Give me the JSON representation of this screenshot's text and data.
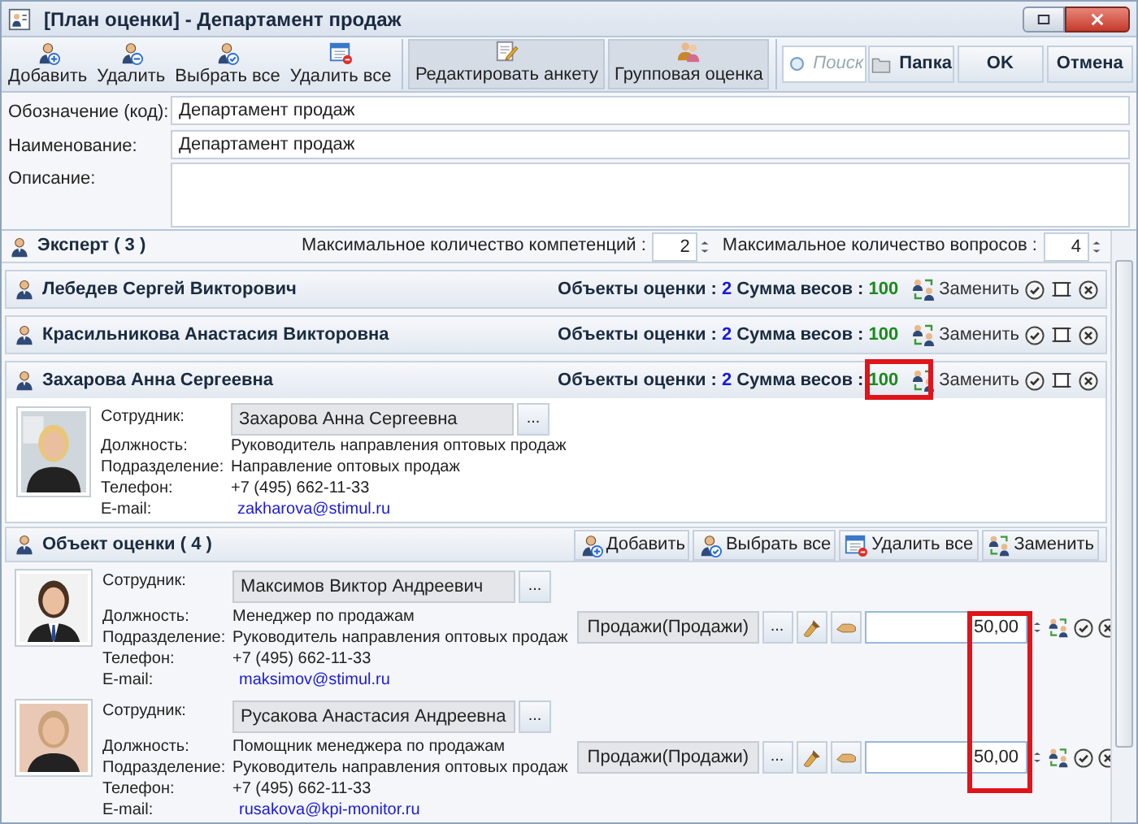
{
  "window": {
    "title": "[План оценки] - Департамент продаж"
  },
  "toolbar": {
    "buttons": [
      {
        "label": "Добавить",
        "kind": "add"
      },
      {
        "label": "Удалить",
        "kind": "remove"
      },
      {
        "label": "Выбрать все",
        "kind": "select"
      },
      {
        "label": "Удалить все",
        "kind": "clear"
      },
      {
        "label": "Редактировать анкету",
        "kind": "edit"
      },
      {
        "label": "Групповая оценка",
        "kind": "group"
      }
    ],
    "search": {
      "placeholder": "Поиск"
    },
    "actions": [
      {
        "label": "Папка",
        "kind": "folder"
      },
      {
        "label": "OK",
        "kind": "plain"
      },
      {
        "label": "Отмена",
        "kind": "plain"
      }
    ]
  },
  "fields": [
    {
      "label": "Обозначение (код):",
      "value": "Департамент продаж",
      "kind": "line"
    },
    {
      "label": "Наименование:",
      "value": "Департамент продаж",
      "kind": "line"
    },
    {
      "label": "Описание:",
      "kind": "area"
    }
  ],
  "experts": {
    "title": "Эксперт ( 3 )",
    "max_competencies": {
      "label": "Максимальное количество компетенций :",
      "value": "2"
    },
    "max_questions": {
      "label": "Максимальное количество вопросов :",
      "value": "4"
    },
    "items": [
      {
        "name": "Лебедев Сергей Викторович",
        "objects_label": "Объекты оценки :",
        "objects_value": "2",
        "weights_label": "Сумма весов :",
        "weights_value": "100",
        "replace": "Заменить"
      },
      {
        "name": "Красильникова Анастасия Викторовна",
        "objects_label": "Объекты оценки :",
        "objects_value": "2",
        "weights_label": "Сумма весов :",
        "weights_value": "100",
        "replace": "Заменить"
      },
      {
        "name": "Захарова Анна Сергеевна",
        "objects_label": "Объекты оценки :",
        "objects_value": "2",
        "weights_label": "Сумма весов :",
        "weights_value": "100",
        "replace": "Заменить",
        "details": [
          {
            "label": "Сотрудник:",
            "value": "Захарова Анна Сергеевна",
            "kind": "field",
            "more": "..."
          },
          {
            "label": "Должность:",
            "value": "Руководитель направления оптовых продаж",
            "kind": "text"
          },
          {
            "label": "Подразделение:",
            "value": "Направление оптовых продаж",
            "kind": "text"
          },
          {
            "label": "Телефон:",
            "value": "+7 (495) 662-11-33",
            "kind": "text"
          },
          {
            "label": "E-mail:",
            "value": "zakharova@stimul.ru",
            "kind": "link"
          }
        ]
      }
    ]
  },
  "objects": {
    "title": "Объект оценки ( 4 )",
    "buttons": [
      {
        "label": "Добавить",
        "kind": "add"
      },
      {
        "label": "Выбрать все",
        "kind": "select"
      },
      {
        "label": "Удалить все",
        "kind": "clear"
      },
      {
        "label": "Заменить",
        "kind": "replace"
      }
    ],
    "items": [
      {
        "details": [
          {
            "label": "Сотрудник:",
            "value": "Максимов Виктор Андреевич",
            "kind": "field",
            "more": "..."
          },
          {
            "label": "Должность:",
            "value": "Менеджер по продажам",
            "kind": "text"
          },
          {
            "label": "Подразделение:",
            "value": "Руководитель направления оптовых продаж",
            "kind": "text"
          },
          {
            "label": "Телефон:",
            "value": "+7 (495) 662-11-33",
            "kind": "text"
          },
          {
            "label": "E-mail:",
            "value": "maksimov@stimul.ru",
            "kind": "link"
          }
        ],
        "competency": "Продажи(Продажи)",
        "more": "...",
        "weight": "50,00"
      },
      {
        "details": [
          {
            "label": "Сотрудник:",
            "value": "Русакова Анастасия Андреевна",
            "kind": "field",
            "more": "..."
          },
          {
            "label": "Должность:",
            "value": "Помощник менеджера по продажам",
            "kind": "text"
          },
          {
            "label": "Подразделение:",
            "value": "Руководитель направления оптовых продаж",
            "kind": "text"
          },
          {
            "label": "Телефон:",
            "value": "+7 (495) 662-11-33",
            "kind": "text"
          },
          {
            "label": "E-mail:",
            "value": "rusakova@kpi-monitor.ru",
            "kind": "link"
          }
        ],
        "competency": "Продажи(Продажи)",
        "more": "...",
        "weight": "50,00"
      }
    ]
  }
}
